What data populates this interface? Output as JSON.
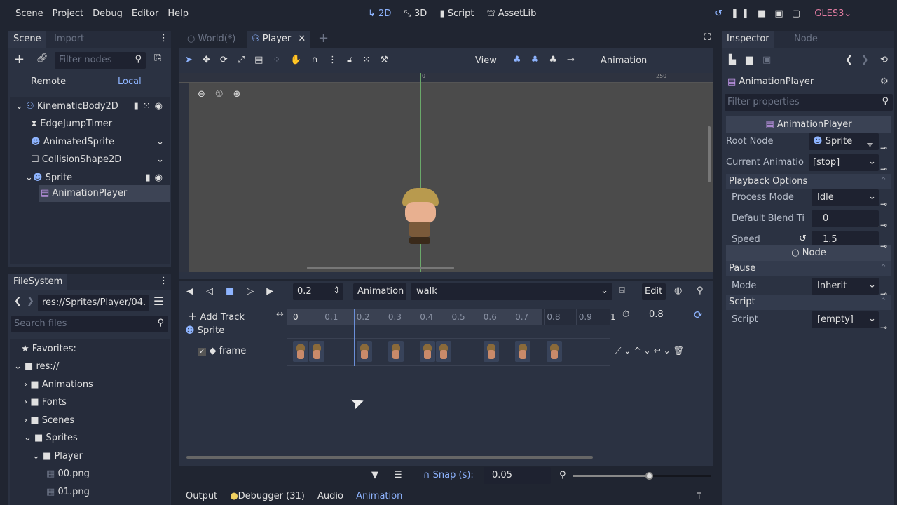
{
  "menu": [
    "Scene",
    "Project",
    "Debug",
    "Editor",
    "Help"
  ],
  "workspaces": [
    {
      "label": "2D",
      "icon": "2d-icon",
      "active": true
    },
    {
      "label": "3D",
      "icon": "3d-icon"
    },
    {
      "label": "Script",
      "icon": "script-icon"
    },
    {
      "label": "AssetLib",
      "icon": "assetlib-icon"
    }
  ],
  "renderer": "GLES3",
  "scene_dock": {
    "tabs": [
      "Scene",
      "Import"
    ],
    "filter_placeholder": "Filter nodes",
    "remote": "Remote",
    "local": "Local",
    "tree": [
      {
        "name": "KinematicBody2D",
        "depth": 0,
        "icon": "kinematicbody-icon"
      },
      {
        "name": "EdgeJumpTimer",
        "depth": 1,
        "icon": "timer-icon"
      },
      {
        "name": "AnimatedSprite",
        "depth": 1,
        "icon": "animatedsprite-icon"
      },
      {
        "name": "CollisionShape2D",
        "depth": 1,
        "icon": "collisionshape-icon"
      },
      {
        "name": "Sprite",
        "depth": 1,
        "icon": "sprite-icon"
      },
      {
        "name": "AnimationPlayer",
        "depth": 2,
        "icon": "animationplayer-icon",
        "selected": true
      }
    ]
  },
  "filesystem": {
    "tab": "FileSystem",
    "path": "res://Sprites/Player/04.",
    "search_placeholder": "Search files",
    "items": [
      {
        "name": "Favorites:",
        "depth": 0,
        "icon": "star-icon"
      },
      {
        "name": "res://",
        "depth": 0,
        "icon": "folder-icon"
      },
      {
        "name": "Animations",
        "depth": 1,
        "icon": "folder-icon"
      },
      {
        "name": "Fonts",
        "depth": 1,
        "icon": "folder-icon"
      },
      {
        "name": "Scenes",
        "depth": 1,
        "icon": "folder-icon"
      },
      {
        "name": "Sprites",
        "depth": 1,
        "icon": "folder-icon"
      },
      {
        "name": "Player",
        "depth": 2,
        "icon": "folder-icon"
      },
      {
        "name": "00.png",
        "depth": 3,
        "icon": "image-icon"
      },
      {
        "name": "01.png",
        "depth": 3,
        "icon": "image-icon"
      }
    ]
  },
  "editor_tabs": [
    {
      "label": "World(*)"
    },
    {
      "label": "Player",
      "active": true
    }
  ],
  "toolbar": {
    "view": "View",
    "animation": "Animation"
  },
  "ruler": {
    "zero": "0",
    "mark": "250"
  },
  "anim": {
    "time": "0.2",
    "animation_label": "Animation",
    "current": "walk",
    "edit": "Edit",
    "add_track": "Add Track",
    "ticks": [
      "0",
      "0.1",
      "0.2",
      "0.3",
      "0.4",
      "0.5",
      "0.6",
      "0.7",
      "0.8",
      "0.9",
      "1"
    ],
    "length": "0.8",
    "track_group": "Sprite",
    "track": "frame",
    "keyframes": [
      0,
      0.05,
      0.2,
      0.3,
      0.4,
      0.45,
      0.6,
      0.7,
      0.8
    ],
    "cursor": 0.2,
    "snap_label": "Snap (s):",
    "snap": "0.05",
    "zoom_level": 0.55
  },
  "bottom_tabs": [
    "Output",
    "Debugger (31)",
    "Audio",
    "Animation"
  ],
  "inspector": {
    "tabs": [
      "Inspector",
      "Node"
    ],
    "object": "AnimationPlayer",
    "filter_placeholder": "Filter properties",
    "section": "AnimationPlayer",
    "props": [
      {
        "label": "Root Node",
        "value": "Sprite"
      },
      {
        "label": "Current Animatio",
        "value": "[stop]"
      }
    ],
    "playback": "Playback Options",
    "playback_props": [
      {
        "label": "Process Mode",
        "value": "Idle"
      },
      {
        "label": "Default Blend Ti",
        "value": "0"
      },
      {
        "label": "Speed",
        "value": "1.5"
      }
    ],
    "node_section": "Node",
    "pause": "Pause",
    "mode_label": "Mode",
    "mode_value": "Inherit",
    "script": "Script",
    "script_label": "Script",
    "script_value": "[empty]"
  },
  "colors": {
    "accent": "#8eb4ff",
    "renderer": "#e07ba0",
    "debugger_dot": "#f0d060"
  }
}
